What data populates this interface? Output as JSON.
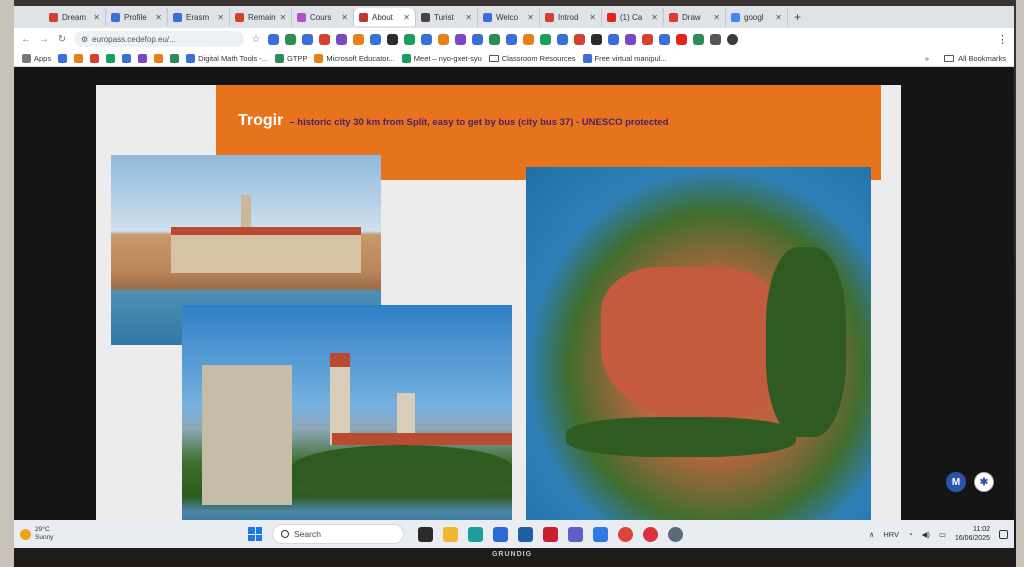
{
  "browser": {
    "tabs": [
      {
        "label": "Dream",
        "color": "#d7402f"
      },
      {
        "label": "Profile",
        "color": "#3a6fd8"
      },
      {
        "label": "Erasm",
        "color": "#3a6fd8"
      },
      {
        "label": "Remain",
        "color": "#d7402f"
      },
      {
        "label": "Cours",
        "color": "#b44fc7"
      },
      {
        "label": "About",
        "color": "#c0392b",
        "active": true
      },
      {
        "label": "Turist",
        "color": "#444444"
      },
      {
        "label": "Welco",
        "color": "#3a6fd8"
      },
      {
        "label": "Introd",
        "color": "#d7402f"
      },
      {
        "label": "(1) Ca",
        "color": "#e62117"
      },
      {
        "label": "Draw",
        "color": "#d7402f"
      },
      {
        "label": "googl",
        "color": "#4285f4"
      }
    ],
    "new_tab": "+",
    "address": "europass.cedefop.eu/...",
    "bookmarks": [
      {
        "label": "Apps",
        "color": "#777777"
      },
      {
        "label": "Digital Math Tools -...",
        "color": "#3a6fd8"
      },
      {
        "label": "GTPP",
        "color": "#2e8b57"
      },
      {
        "label": "Microsoft Educator...",
        "color": "#e6801a"
      },
      {
        "label": "Meet – nyo-gxet-syu",
        "color": "#1a9e5b"
      },
      {
        "label": "Classroom Resources",
        "color": "#555555"
      },
      {
        "label": "Free virtual manipul...",
        "color": "#3a6fd8"
      }
    ],
    "more_bookmarks": "»",
    "all_bookmarks": "All Bookmarks"
  },
  "slide": {
    "title": "Trogir",
    "subtitle": "– historic city 30 km from Split, easy to get by bus (city bus 37) - UNESCO protected",
    "accent_color": "#e8731d"
  },
  "taskbar": {
    "weather_temp": "29°C",
    "weather_desc": "Sunny",
    "search_placeholder": "Search",
    "language": "HRV",
    "time": "11:02",
    "date": "16/06/2025"
  },
  "monitor_brand": "GRUNDIG"
}
